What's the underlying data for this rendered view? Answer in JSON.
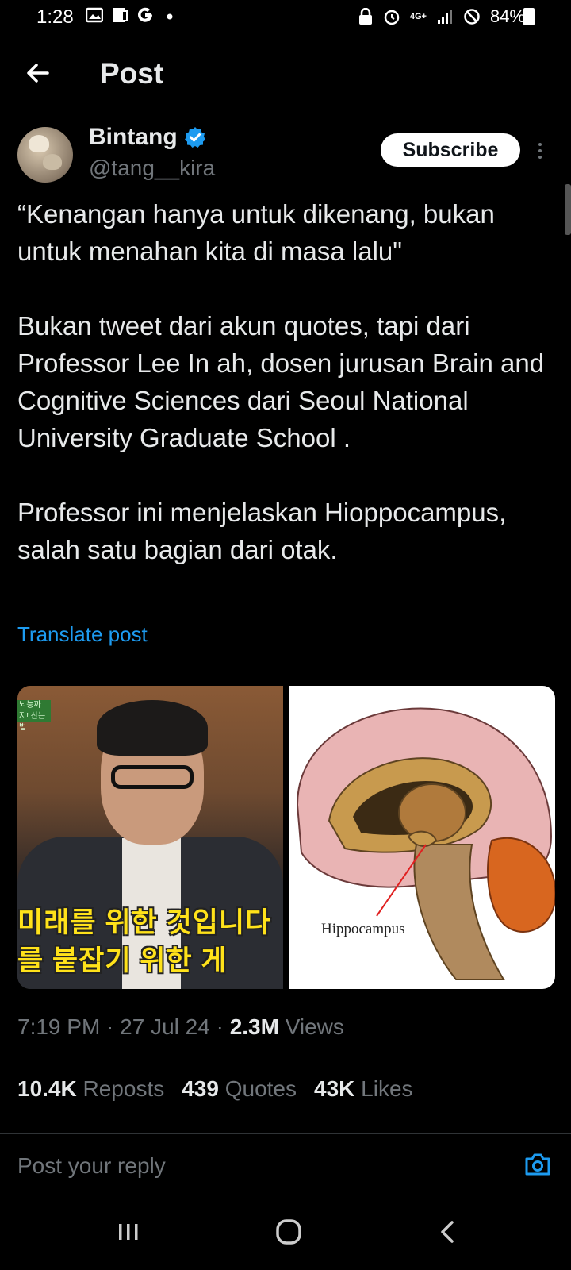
{
  "status_bar": {
    "time": "1:28",
    "left_icons": [
      "image-icon",
      "device-icon",
      "google-icon",
      "dot-icon"
    ],
    "right_icons": [
      "lock-icon",
      "alarm-icon",
      "4g-icon",
      "signal-icon",
      "dnd-icon"
    ],
    "network_label": "4G+",
    "battery": "84%"
  },
  "app_bar": {
    "title": "Post"
  },
  "post": {
    "author_name": "Bintang",
    "author_handle": "@tang__kira",
    "subscribe_label": "Subscribe",
    "paragraphs": [
      "“Kenangan hanya untuk dikenang, bukan untuk menahan kita di masa lalu\"",
      "Bukan tweet dari akun quotes, tapi dari Professor Lee In ah, dosen jurusan Brain and Cognitive Sciences dari Seoul National University Graduate School .",
      "Professor ini menjelaskan Hioppocampus, salah satu bagian dari otak."
    ],
    "translate_label": "Translate post",
    "media": {
      "image1_caption_line1": "미래를 위한 것입니다",
      "image1_caption_line2": "를 붙잡기 위한 게",
      "image1_tag": "뇌능까지! 산는 법",
      "image2_label": "Hippocampus"
    },
    "timestamp": "7:19 PM · 27 Jul 24 · ",
    "views_count": "2.3M",
    "views_label": "Views",
    "reposts_count": "10.4K",
    "reposts_label": "Reposts",
    "quotes_count": "439",
    "quotes_label": "Quotes",
    "likes_count": "43K",
    "likes_label": "Likes"
  },
  "reply": {
    "placeholder": "Post your reply"
  },
  "colors": {
    "accent": "#1d9bf0",
    "background": "#000000",
    "muted": "#71767b",
    "text": "#e7e9ea"
  }
}
